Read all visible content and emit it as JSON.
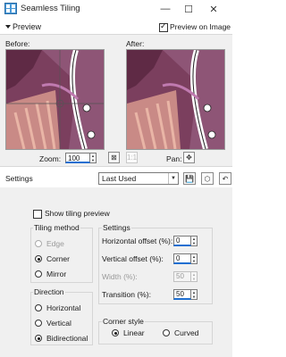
{
  "window": {
    "title": "Seamless Tiling"
  },
  "preview": {
    "section_label": "Preview",
    "preview_on_image_label": "Preview on Image",
    "preview_on_image_checked": true,
    "before_label": "Before:",
    "after_label": "After:",
    "zoom_label": "Zoom:",
    "zoom_value": "100",
    "pan_label": "Pan:"
  },
  "settings": {
    "label": "Settings",
    "preset_value": "Last Used",
    "show_tiling_preview_label": "Show tiling preview",
    "show_tiling_preview_checked": false
  },
  "tiling_method": {
    "title": "Tiling method",
    "options": [
      {
        "label": "Edge",
        "selected": false,
        "enabled": false
      },
      {
        "label": "Corner",
        "selected": true,
        "enabled": true
      },
      {
        "label": "Mirror",
        "selected": false,
        "enabled": true
      }
    ]
  },
  "direction": {
    "title": "Direction",
    "options": [
      {
        "label": "Horizontal",
        "selected": false
      },
      {
        "label": "Vertical",
        "selected": false
      },
      {
        "label": "Bidirectional",
        "selected": true
      }
    ]
  },
  "settings_group": {
    "title": "Settings",
    "fields": [
      {
        "label": "Horizontal offset (%):",
        "value": "0",
        "enabled": true
      },
      {
        "label": "Vertical offset (%):",
        "value": "0",
        "enabled": true
      },
      {
        "label": "Width (%):",
        "value": "50",
        "enabled": false
      },
      {
        "label": "Transition (%):",
        "value": "50",
        "enabled": true
      }
    ]
  },
  "corner_style": {
    "title": "Corner style",
    "options": [
      {
        "label": "Linear",
        "selected": true
      },
      {
        "label": "Curved",
        "selected": false
      }
    ]
  },
  "colors": {
    "accent": "#1f6fd1",
    "panel_bg": "#f0f0f0",
    "image_purple": "#7a4660"
  },
  "icons": [
    "app-icon",
    "minimize-icon",
    "maximize-icon",
    "close-icon",
    "fit-window-icon",
    "actual-size-icon",
    "pan-icon",
    "save-preset-icon",
    "delete-preset-icon",
    "reset-icon"
  ]
}
